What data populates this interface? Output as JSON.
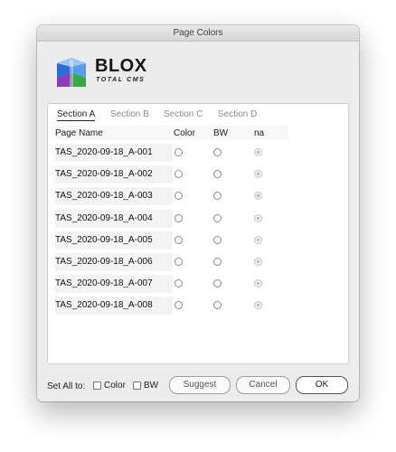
{
  "window": {
    "title": "Page Colors"
  },
  "logo": {
    "word": "BLOX",
    "sub": "TOTAL CMS"
  },
  "tabs": [
    {
      "label": "Section A",
      "active": true
    },
    {
      "label": "Section B",
      "active": false
    },
    {
      "label": "Section C",
      "active": false
    },
    {
      "label": "Section D",
      "active": false
    }
  ],
  "table": {
    "headers": {
      "name": "Page Name",
      "color": "Color",
      "bw": "BW",
      "na": "na"
    },
    "rows": [
      {
        "name": "TAS_2020-09-18_A-001",
        "selected": "na"
      },
      {
        "name": "TAS_2020-09-18_A-002",
        "selected": "na"
      },
      {
        "name": "TAS_2020-09-18_A-003",
        "selected": "na"
      },
      {
        "name": "TAS_2020-09-18_A-004",
        "selected": "na"
      },
      {
        "name": "TAS_2020-09-18_A-005",
        "selected": "na"
      },
      {
        "name": "TAS_2020-09-18_A-006",
        "selected": "na"
      },
      {
        "name": "TAS_2020-09-18_A-007",
        "selected": "na"
      },
      {
        "name": "TAS_2020-09-18_A-008",
        "selected": "na"
      }
    ]
  },
  "footer": {
    "set_all_label": "Set All to:",
    "color_checkbox": {
      "label": "Color",
      "checked": false
    },
    "bw_checkbox": {
      "label": "BW",
      "checked": false
    },
    "suggest_label": "Suggest",
    "cancel_label": "Cancel",
    "ok_label": "OK"
  },
  "colors": {
    "logo_blue": "#2a6fd8",
    "logo_green": "#3aa845",
    "logo_purple": "#8a3fb8",
    "logo_red": "#e0453a"
  }
}
